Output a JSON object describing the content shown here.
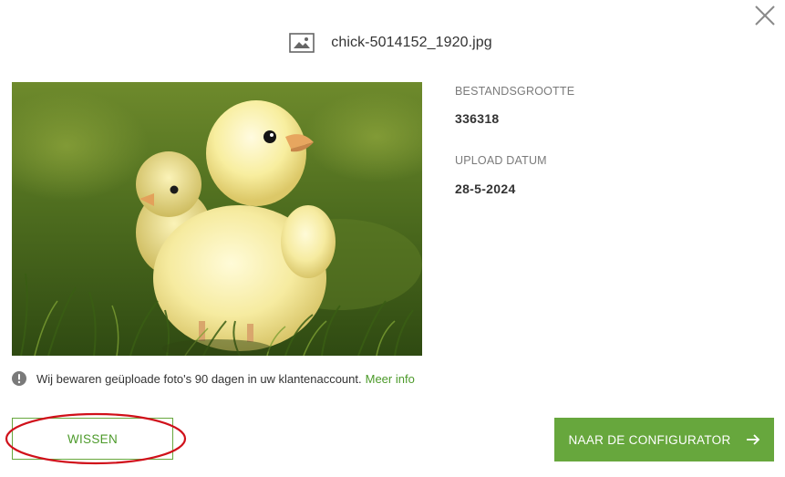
{
  "dialog": {
    "file_name": "chick-5014152_1920.jpg",
    "file_icon": "image-icon",
    "close_icon": "close-icon"
  },
  "preview": {
    "image_description_icon": "photo-preview"
  },
  "details": {
    "size_label": "BESTANDSGROOTTE",
    "size_value": "336318",
    "upload_label": "UPLOAD DATUM",
    "upload_value": "28-5-2024"
  },
  "notice": {
    "icon": "exclamation-circle-icon",
    "text": "Wij bewaren geüploade foto's 90 dagen in uw klantenaccount.",
    "link_text": "Meer info"
  },
  "actions": {
    "delete_label": "WISSEN",
    "configurator_label": "NAAR DE CONFIGURATOR",
    "configurator_icon": "arrow-right-icon"
  },
  "colors": {
    "accent": "#67a73d",
    "link": "#4c9a2a",
    "highlight": "#d0101a"
  }
}
